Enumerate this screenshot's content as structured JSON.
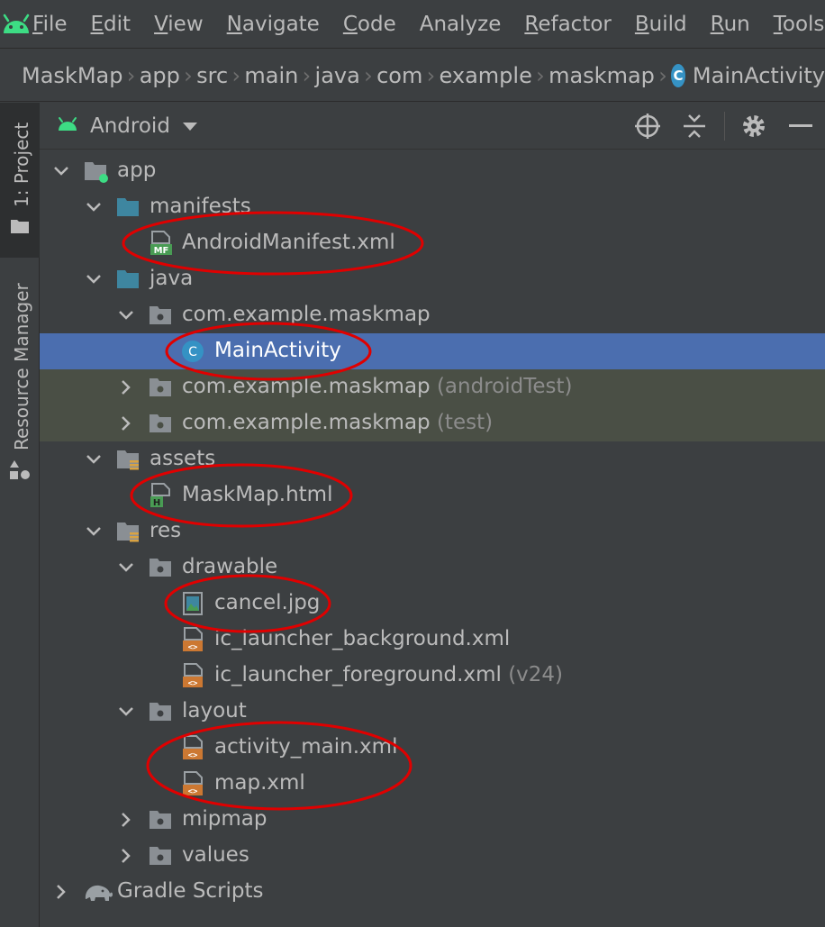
{
  "menu": {
    "items": [
      {
        "mnemonic": "F",
        "rest": "ile"
      },
      {
        "mnemonic": "E",
        "rest": "dit"
      },
      {
        "mnemonic": "V",
        "rest": "iew"
      },
      {
        "mnemonic": "N",
        "rest": "avigate"
      },
      {
        "mnemonic": "C",
        "rest": "ode"
      },
      {
        "mnemonic": "",
        "rest": "Analyze"
      },
      {
        "mnemonic": "R",
        "rest": "efactor"
      },
      {
        "mnemonic": "B",
        "rest": "uild"
      },
      {
        "mnemonic": "R",
        "rest": "un"
      },
      {
        "mnemonic": "T",
        "rest": "ools"
      }
    ]
  },
  "breadcrumb": {
    "items": [
      "MaskMap",
      "app",
      "src",
      "main",
      "java",
      "com",
      "example",
      "maskmap"
    ],
    "last": "MainActivity",
    "last_icon_letter": "C"
  },
  "toolstrip": {
    "project_tab": "1: Project",
    "resource_manager": "Resource Manager"
  },
  "panel": {
    "view_mode": "Android"
  },
  "tree": {
    "app": "app",
    "manifests": "manifests",
    "android_manifest": "AndroidManifest.xml",
    "manifest_badge": "MF",
    "java": "java",
    "pkg_main": "com.example.maskmap",
    "main_activity": "MainActivity",
    "class_letter": "C",
    "pkg_android_test": "com.example.maskmap",
    "pkg_android_test_suffix": "(androidTest)",
    "pkg_test": "com.example.maskmap",
    "pkg_test_suffix": "(test)",
    "assets": "assets",
    "maskmap_html": "MaskMap.html",
    "html_badge": "H",
    "res": "res",
    "drawable": "drawable",
    "cancel_jpg": "cancel.jpg",
    "ic_launcher_background": "ic_launcher_background.xml",
    "ic_launcher_foreground": "ic_launcher_foreground.xml",
    "ic_launcher_foreground_suffix": "(v24)",
    "layout": "layout",
    "activity_main": "activity_main.xml",
    "map_xml": "map.xml",
    "mipmap": "mipmap",
    "values": "values",
    "gradle_scripts": "Gradle Scripts",
    "xml_badge": "<>"
  },
  "colors": {
    "background": "#3c3f41",
    "selection": "#4b6eaf",
    "test_source_bg": "#4a4f45",
    "android_green": "#3ddc84",
    "folder_blue": "#3e86a0",
    "annotation_red": "#e00000"
  }
}
